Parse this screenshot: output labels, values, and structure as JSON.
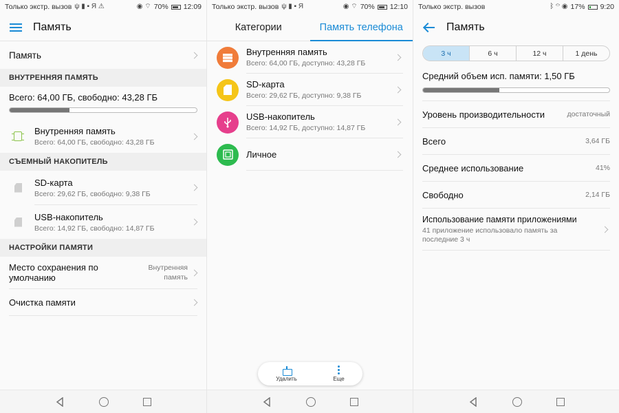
{
  "screens": [
    {
      "status": {
        "left": "Только экстр. вызов",
        "battery": "70%",
        "time": "12:09"
      },
      "appbar_title": "Память",
      "top_item": "Память",
      "internal": {
        "header": "ВНУТРЕННЯЯ ПАМЯТЬ",
        "summary": "Всего: 64,00 ГБ, свободно: 43,28 ГБ",
        "used_fraction": 0.32,
        "item": {
          "title": "Внутренняя память",
          "subtitle": "Всего: 64,00 ГБ, свободно: 43,28 ГБ"
        }
      },
      "removable": {
        "header": "СЪЕМНЫЙ НАКОПИТЕЛЬ",
        "items": [
          {
            "title": "SD-карта",
            "subtitle": "Всего: 29,62 ГБ, свободно: 9,38 ГБ"
          },
          {
            "title": "USB-накопитель",
            "subtitle": "Всего: 14,92 ГБ, свободно: 14,87 ГБ"
          }
        ]
      },
      "settings": {
        "header": "НАСТРОЙКИ ПАМЯТИ",
        "default_location": {
          "label": "Место сохранения по умолчанию",
          "value": "Внутренняя память"
        },
        "cleanup": "Очистка памяти"
      }
    },
    {
      "status": {
        "left": "Только экстр. вызов",
        "battery": "70%",
        "time": "12:10"
      },
      "tabs": [
        "Категории",
        "Память телефона"
      ],
      "active_tab": 1,
      "items": [
        {
          "title": "Внутренняя память",
          "subtitle": "Всего: 64,00 ГБ, доступно: 43,28 ГБ",
          "color": "#f07c3a",
          "icon": "storage-icon"
        },
        {
          "title": "SD-карта",
          "subtitle": "Всего: 29,62 ГБ, доступно: 9,38 ГБ",
          "color": "#f5c518",
          "icon": "sd-card-icon"
        },
        {
          "title": "USB-накопитель",
          "subtitle": "Всего: 14,92 ГБ, доступно: 14,87 ГБ",
          "color": "#e63f8c",
          "icon": "usb-icon"
        },
        {
          "title": "Личное",
          "subtitle": "",
          "color": "#2dbb4f",
          "icon": "safe-icon"
        }
      ],
      "actions": {
        "delete": "Удалить",
        "more": "Еще"
      }
    },
    {
      "status": {
        "left": "Только экстр. вызов",
        "battery": "17%",
        "time": "9:20"
      },
      "appbar_title": "Память",
      "segments": [
        "3 ч",
        "6 ч",
        "12 ч",
        "1 день"
      ],
      "active_segment": 0,
      "avg_label": "Средний объем исп. памяти: 1,50 ГБ",
      "avg_fraction": 0.41,
      "rows": [
        {
          "k": "Уровень производительности",
          "v": "достаточный"
        },
        {
          "k": "Всего",
          "v": "3,64 ГБ"
        },
        {
          "k": "Среднее использование",
          "v": "41%"
        },
        {
          "k": "Свободно",
          "v": "2,14 ГБ"
        }
      ],
      "app_usage": {
        "title": "Использование памяти приложениями",
        "subtitle": "41 приложение использовало память за последние 3 ч"
      }
    }
  ],
  "colors": {
    "accent": "#1a8bd6"
  }
}
